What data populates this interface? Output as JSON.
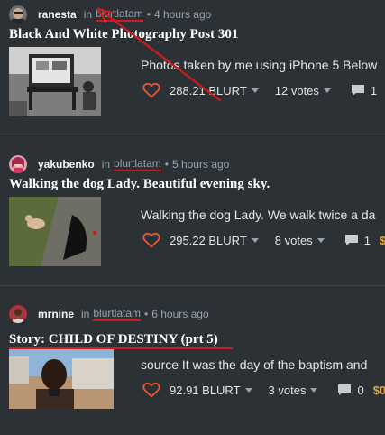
{
  "feed": {
    "posts": [
      {
        "author": "ranesta",
        "in_label": "in",
        "community": "blurtlatam",
        "time": "4 hours ago",
        "title": "Black And White Photography Post 301",
        "summary": "Photos taken by me using iPhone 5 Below",
        "payout": "288.21 BLURT",
        "votes": "12 votes",
        "comments": "1",
        "extra": ""
      },
      {
        "author": "yakubenko",
        "in_label": "in",
        "community": "blurtlatam",
        "time": "5 hours ago",
        "title": "Walking the dog Lady. Beautiful evening sky.",
        "summary": "Walking the dog Lady. We walk twice a da",
        "payout": "295.22 BLURT",
        "votes": "8 votes",
        "comments": "1",
        "extra": "$"
      },
      {
        "author": "mrnine",
        "in_label": "in",
        "community": "blurtlatam",
        "time": "6 hours ago",
        "title": "Story: CHILD OF DESTINY (prt 5)",
        "summary": "source It was the day of the baptism and",
        "payout": "92.91 BLURT",
        "votes": "3 votes",
        "comments": "0",
        "extra": "$0"
      }
    ]
  },
  "colors": {
    "background": "#2c3136",
    "accent": "#e6592e",
    "annotation": "#d11a1a"
  },
  "icons": [
    "heart-icon",
    "comment-icon",
    "caret-down-icon",
    "avatar"
  ]
}
